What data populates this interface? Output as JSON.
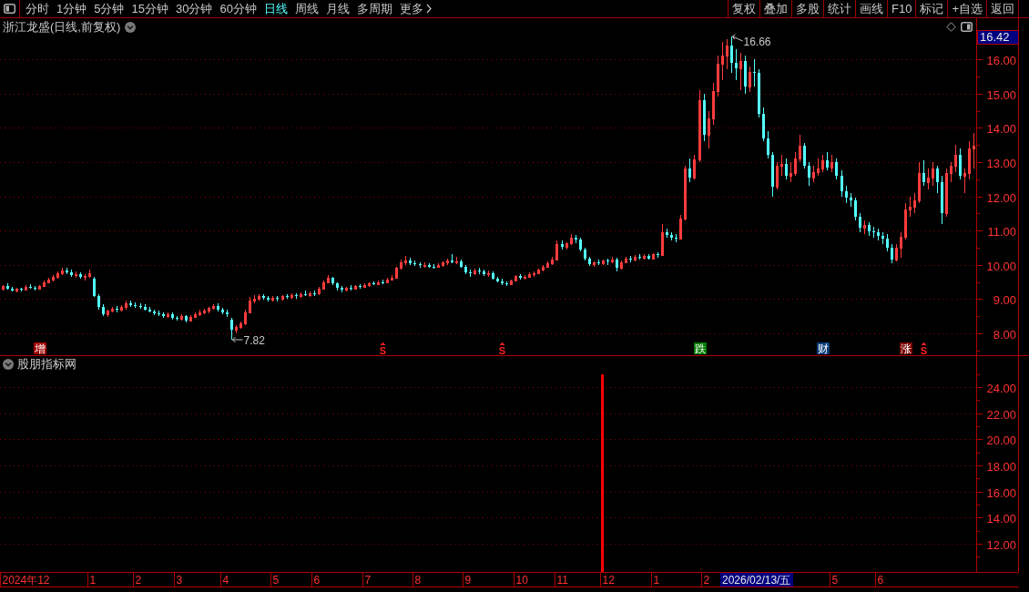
{
  "toolbar": {
    "periods": [
      {
        "label": "分时",
        "selected": false,
        "kind": "period"
      },
      {
        "label": "1分钟",
        "selected": false,
        "kind": "period"
      },
      {
        "label": "5分钟",
        "selected": false,
        "kind": "period"
      },
      {
        "label": "15分钟",
        "selected": false,
        "kind": "period"
      },
      {
        "label": "30分钟",
        "selected": false,
        "kind": "period"
      },
      {
        "label": "60分钟",
        "selected": false,
        "kind": "period"
      },
      {
        "label": "日线",
        "selected": true,
        "kind": "period"
      },
      {
        "label": "周线",
        "selected": false,
        "kind": "period"
      },
      {
        "label": "月线",
        "selected": false,
        "kind": "period"
      },
      {
        "label": "多周期",
        "selected": false,
        "kind": "period"
      },
      {
        "label": "更多",
        "selected": false,
        "kind": "menu"
      }
    ],
    "actions": [
      "复权",
      "叠加",
      "多股",
      "统计",
      "画线",
      "F10",
      "标记",
      "+自选",
      "返回"
    ]
  },
  "price_pane": {
    "title": "浙江龙盛(日线,前复权)",
    "price_label": "16.42",
    "event_markers": [
      {
        "kind": "badge",
        "label": "增",
        "color": "#a00000"
      },
      {
        "kind": "signal",
        "label": "S"
      },
      {
        "kind": "signal",
        "label": "S"
      },
      {
        "kind": "badge",
        "label": "跌",
        "color": "#007a00"
      },
      {
        "kind": "badge",
        "label": "财",
        "color": "#0a3c78"
      },
      {
        "kind": "badge",
        "label": "涨",
        "color": "#7a0000"
      },
      {
        "kind": "signal",
        "label": "S"
      }
    ],
    "chart_data": [
      {
        "type": "candlestick",
        "ylim": [
          7.36,
          17.2
        ],
        "grid": true,
        "yticks": [
          {
            "value": 16,
            "label": "16.00"
          },
          {
            "value": 15,
            "label": "15.00"
          },
          {
            "value": 14,
            "label": "14.00"
          },
          {
            "value": 13,
            "label": "13.00"
          },
          {
            "value": 12,
            "label": "12.00"
          },
          {
            "value": 11,
            "label": "11.00"
          },
          {
            "value": 10,
            "label": "10.00"
          },
          {
            "value": 9,
            "label": "9.00"
          },
          {
            "value": 8,
            "label": "8.00"
          }
        ],
        "annotations": [
          "16.66",
          "7.82"
        ],
        "ohlc": [
          [
            9.3,
            9.42,
            9.26,
            9.38
          ],
          [
            9.38,
            9.45,
            9.28,
            9.31
          ],
          [
            9.31,
            9.36,
            9.22,
            9.25
          ],
          [
            9.25,
            9.33,
            9.2,
            9.3
          ],
          [
            9.3,
            9.34,
            9.21,
            9.27
          ],
          [
            9.27,
            9.4,
            9.25,
            9.36
          ],
          [
            9.36,
            9.44,
            9.3,
            9.33
          ],
          [
            9.33,
            9.38,
            9.24,
            9.29
          ],
          [
            9.29,
            9.41,
            9.27,
            9.38
          ],
          [
            9.38,
            9.55,
            9.35,
            9.5
          ],
          [
            9.5,
            9.62,
            9.45,
            9.58
          ],
          [
            9.58,
            9.7,
            9.52,
            9.66
          ],
          [
            9.66,
            9.8,
            9.6,
            9.75
          ],
          [
            9.75,
            9.9,
            9.7,
            9.84
          ],
          [
            9.84,
            9.92,
            9.72,
            9.78
          ],
          [
            9.78,
            9.86,
            9.66,
            9.7
          ],
          [
            9.7,
            9.8,
            9.62,
            9.74
          ],
          [
            9.74,
            9.78,
            9.6,
            9.65
          ],
          [
            9.65,
            9.72,
            9.55,
            9.67
          ],
          [
            9.67,
            9.85,
            9.62,
            9.75
          ],
          [
            9.6,
            9.66,
            9.05,
            9.1
          ],
          [
            9.1,
            9.15,
            8.7,
            8.78
          ],
          [
            8.78,
            8.85,
            8.5,
            8.55
          ],
          [
            8.55,
            8.7,
            8.48,
            8.66
          ],
          [
            8.66,
            8.78,
            8.6,
            8.72
          ],
          [
            8.72,
            8.8,
            8.62,
            8.68
          ],
          [
            8.68,
            8.82,
            8.64,
            8.76
          ],
          [
            8.76,
            8.95,
            8.7,
            8.88
          ],
          [
            8.88,
            8.96,
            8.78,
            8.82
          ],
          [
            8.82,
            8.9,
            8.74,
            8.8
          ],
          [
            8.8,
            8.88,
            8.72,
            8.78
          ],
          [
            8.78,
            8.84,
            8.66,
            8.7
          ],
          [
            8.7,
            8.76,
            8.6,
            8.64
          ],
          [
            8.64,
            8.7,
            8.52,
            8.58
          ],
          [
            8.58,
            8.66,
            8.5,
            8.55
          ],
          [
            8.55,
            8.62,
            8.44,
            8.5
          ],
          [
            8.5,
            8.6,
            8.46,
            8.56
          ],
          [
            8.56,
            8.62,
            8.4,
            8.44
          ],
          [
            8.44,
            8.5,
            8.36,
            8.42
          ],
          [
            8.42,
            8.55,
            8.38,
            8.5
          ],
          [
            8.5,
            8.54,
            8.32,
            8.37
          ],
          [
            8.37,
            8.52,
            8.34,
            8.48
          ],
          [
            8.48,
            8.62,
            8.44,
            8.56
          ],
          [
            8.56,
            8.68,
            8.5,
            8.6
          ],
          [
            8.6,
            8.72,
            8.55,
            8.66
          ],
          [
            8.66,
            8.78,
            8.58,
            8.74
          ],
          [
            8.74,
            8.86,
            8.68,
            8.8
          ],
          [
            8.8,
            8.88,
            8.64,
            8.69
          ],
          [
            8.69,
            8.75,
            8.56,
            8.62
          ],
          [
            8.62,
            8.7,
            8.48,
            8.55
          ],
          [
            8.4,
            8.45,
            7.82,
            8.1
          ],
          [
            8.1,
            8.25,
            8.0,
            8.18
          ],
          [
            8.18,
            8.35,
            8.12,
            8.29
          ],
          [
            8.29,
            8.7,
            8.25,
            8.62
          ],
          [
            8.62,
            9.05,
            8.58,
            8.95
          ],
          [
            8.95,
            9.12,
            8.88,
            9.02
          ],
          [
            9.02,
            9.15,
            8.96,
            9.08
          ],
          [
            9.08,
            9.14,
            8.98,
            9.04
          ],
          [
            9.04,
            9.1,
            8.94,
            8.98
          ],
          [
            8.98,
            9.08,
            8.92,
            9.03
          ],
          [
            9.03,
            9.1,
            8.94,
            9.0
          ],
          [
            9.0,
            9.12,
            8.96,
            9.08
          ],
          [
            9.08,
            9.15,
            9.0,
            9.05
          ],
          [
            9.05,
            9.16,
            9.02,
            9.12
          ],
          [
            9.12,
            9.18,
            9.02,
            9.08
          ],
          [
            9.08,
            9.2,
            9.04,
            9.15
          ],
          [
            9.15,
            9.24,
            9.08,
            9.12
          ],
          [
            9.12,
            9.22,
            9.06,
            9.18
          ],
          [
            9.18,
            9.26,
            9.1,
            9.16
          ],
          [
            9.16,
            9.35,
            9.12,
            9.3
          ],
          [
            9.3,
            9.55,
            9.28,
            9.5
          ],
          [
            9.5,
            9.7,
            9.45,
            9.62
          ],
          [
            9.62,
            9.66,
            9.4,
            9.45
          ],
          [
            9.45,
            9.5,
            9.26,
            9.32
          ],
          [
            9.32,
            9.38,
            9.2,
            9.27
          ],
          [
            9.27,
            9.36,
            9.22,
            9.33
          ],
          [
            9.33,
            9.4,
            9.26,
            9.3
          ],
          [
            9.3,
            9.42,
            9.28,
            9.38
          ],
          [
            9.38,
            9.44,
            9.3,
            9.35
          ],
          [
            9.35,
            9.46,
            9.32,
            9.42
          ],
          [
            9.42,
            9.5,
            9.36,
            9.45
          ],
          [
            9.45,
            9.52,
            9.4,
            9.44
          ],
          [
            9.44,
            9.55,
            9.42,
            9.5
          ],
          [
            9.5,
            9.58,
            9.44,
            9.48
          ],
          [
            9.48,
            9.62,
            9.45,
            9.58
          ],
          [
            9.58,
            9.7,
            9.55,
            9.62
          ],
          [
            9.62,
            9.95,
            9.6,
            9.9
          ],
          [
            9.9,
            10.15,
            9.86,
            10.07
          ],
          [
            10.07,
            10.25,
            10.0,
            10.12
          ],
          [
            10.12,
            10.2,
            9.98,
            10.05
          ],
          [
            10.05,
            10.12,
            9.96,
            10.02
          ],
          [
            10.02,
            10.08,
            9.92,
            9.98
          ],
          [
            9.98,
            10.06,
            9.9,
            10.0
          ],
          [
            10.0,
            10.04,
            9.9,
            9.95
          ],
          [
            9.95,
            10.02,
            9.88,
            9.94
          ],
          [
            9.94,
            10.05,
            9.9,
            10.0
          ],
          [
            10.0,
            10.1,
            9.95,
            10.06
          ],
          [
            10.06,
            10.18,
            10.0,
            10.12
          ],
          [
            10.12,
            10.3,
            10.05,
            10.08
          ],
          [
            10.08,
            10.22,
            10.02,
            10.1
          ],
          [
            10.1,
            10.14,
            9.9,
            9.95
          ],
          [
            9.95,
            10.0,
            9.72,
            9.78
          ],
          [
            9.78,
            9.85,
            9.66,
            9.75
          ],
          [
            9.75,
            9.88,
            9.7,
            9.84
          ],
          [
            9.84,
            9.92,
            9.74,
            9.8
          ],
          [
            9.8,
            9.86,
            9.68,
            9.72
          ],
          [
            9.72,
            9.82,
            9.66,
            9.75
          ],
          [
            9.75,
            9.8,
            9.56,
            9.6
          ],
          [
            9.6,
            9.66,
            9.48,
            9.52
          ],
          [
            9.52,
            9.6,
            9.4,
            9.46
          ],
          [
            9.46,
            9.52,
            9.38,
            9.43
          ],
          [
            9.43,
            9.58,
            9.4,
            9.55
          ],
          [
            9.55,
            9.7,
            9.52,
            9.67
          ],
          [
            9.67,
            9.74,
            9.58,
            9.62
          ],
          [
            9.62,
            9.7,
            9.56,
            9.66
          ],
          [
            9.66,
            9.78,
            9.62,
            9.72
          ],
          [
            9.72,
            9.8,
            9.66,
            9.75
          ],
          [
            9.75,
            9.88,
            9.72,
            9.85
          ],
          [
            9.85,
            9.98,
            9.8,
            9.94
          ],
          [
            9.94,
            10.1,
            9.9,
            10.05
          ],
          [
            10.05,
            10.22,
            10.0,
            10.15
          ],
          [
            10.15,
            10.7,
            10.12,
            10.6
          ],
          [
            10.6,
            10.72,
            10.45,
            10.52
          ],
          [
            10.52,
            10.66,
            10.44,
            10.62
          ],
          [
            10.62,
            10.9,
            10.58,
            10.8
          ],
          [
            10.8,
            10.88,
            10.62,
            10.73
          ],
          [
            10.73,
            10.78,
            10.4,
            10.45
          ],
          [
            10.45,
            10.5,
            10.12,
            10.18
          ],
          [
            10.18,
            10.24,
            9.96,
            10.02
          ],
          [
            10.02,
            10.1,
            9.94,
            10.06
          ],
          [
            10.06,
            10.14,
            10.0,
            10.04
          ],
          [
            10.04,
            10.16,
            10.0,
            10.12
          ],
          [
            10.12,
            10.18,
            9.98,
            10.1
          ],
          [
            10.1,
            10.22,
            10.04,
            10.16
          ],
          [
            10.16,
            10.2,
            9.8,
            9.9
          ],
          [
            9.9,
            10.12,
            9.86,
            10.08
          ],
          [
            10.08,
            10.24,
            10.04,
            10.17
          ],
          [
            10.17,
            10.26,
            10.08,
            10.14
          ],
          [
            10.14,
            10.28,
            10.1,
            10.22
          ],
          [
            10.22,
            10.3,
            10.14,
            10.2
          ],
          [
            10.2,
            10.32,
            10.16,
            10.25
          ],
          [
            10.25,
            10.3,
            10.14,
            10.18
          ],
          [
            10.18,
            10.34,
            10.14,
            10.3
          ],
          [
            10.3,
            10.36,
            10.2,
            10.28
          ],
          [
            10.28,
            11.2,
            10.26,
            10.95
          ],
          [
            10.95,
            11.05,
            10.8,
            10.88
          ],
          [
            10.88,
            10.95,
            10.7,
            10.78
          ],
          [
            10.78,
            10.9,
            10.66,
            10.76
          ],
          [
            10.76,
            11.45,
            10.74,
            11.35
          ],
          [
            11.35,
            12.9,
            11.3,
            12.8
          ],
          [
            12.8,
            13.1,
            12.4,
            12.55
          ],
          [
            12.55,
            13.2,
            12.5,
            13.07
          ],
          [
            13.07,
            15.1,
            13.0,
            14.8
          ],
          [
            14.8,
            15.0,
            13.6,
            13.8
          ],
          [
            13.8,
            14.5,
            13.4,
            14.27
          ],
          [
            14.27,
            15.3,
            14.1,
            15.07
          ],
          [
            15.07,
            16.1,
            14.9,
            15.87
          ],
          [
            15.87,
            16.5,
            15.4,
            16.1
          ],
          [
            16.1,
            16.6,
            15.7,
            16.4
          ],
          [
            16.4,
            16.66,
            15.6,
            15.9
          ],
          [
            15.9,
            16.3,
            15.4,
            15.73
          ],
          [
            15.73,
            16.2,
            15.1,
            15.95
          ],
          [
            15.95,
            16.1,
            15.0,
            15.2
          ],
          [
            15.2,
            15.8,
            15.05,
            15.62
          ],
          [
            15.62,
            16.0,
            15.2,
            15.6
          ],
          [
            15.6,
            15.7,
            14.3,
            14.4
          ],
          [
            14.4,
            14.6,
            13.6,
            13.7
          ],
          [
            13.7,
            13.9,
            13.1,
            13.2
          ],
          [
            13.2,
            13.3,
            12.0,
            12.28
          ],
          [
            12.28,
            13.0,
            12.2,
            12.9
          ],
          [
            12.9,
            13.2,
            12.6,
            12.94
          ],
          [
            12.94,
            13.1,
            12.5,
            12.6
          ],
          [
            12.6,
            13.0,
            12.4,
            12.67
          ],
          [
            12.67,
            13.3,
            12.6,
            13.1
          ],
          [
            13.1,
            13.8,
            13.0,
            13.47
          ],
          [
            13.47,
            13.55,
            12.8,
            12.9
          ],
          [
            12.9,
            13.0,
            12.3,
            12.54
          ],
          [
            12.54,
            12.9,
            12.4,
            12.7
          ],
          [
            12.7,
            13.1,
            12.6,
            12.8
          ],
          [
            12.8,
            13.2,
            12.7,
            13.05
          ],
          [
            13.05,
            13.3,
            12.75,
            12.85
          ],
          [
            12.85,
            13.2,
            12.7,
            13.0
          ],
          [
            13.0,
            13.1,
            12.5,
            12.6
          ],
          [
            12.6,
            12.75,
            12.0,
            12.14
          ],
          [
            12.14,
            12.3,
            11.8,
            11.95
          ],
          [
            11.95,
            12.1,
            11.7,
            11.88
          ],
          [
            11.88,
            11.95,
            11.3,
            11.4
          ],
          [
            11.4,
            11.5,
            10.95,
            11.08
          ],
          [
            11.08,
            11.3,
            10.9,
            11.15
          ],
          [
            11.15,
            11.25,
            10.85,
            10.98
          ],
          [
            10.98,
            11.1,
            10.8,
            10.95
          ],
          [
            10.95,
            11.05,
            10.7,
            10.85
          ],
          [
            10.85,
            10.95,
            10.6,
            10.76
          ],
          [
            10.76,
            10.9,
            10.4,
            10.5
          ],
          [
            10.5,
            10.6,
            10.05,
            10.15
          ],
          [
            10.15,
            10.6,
            10.1,
            10.5
          ],
          [
            10.5,
            10.95,
            10.2,
            10.81
          ],
          [
            10.81,
            11.8,
            10.75,
            11.61
          ],
          [
            11.61,
            12.0,
            11.4,
            11.7
          ],
          [
            11.7,
            12.1,
            11.5,
            11.88
          ],
          [
            11.88,
            13.0,
            11.8,
            12.67
          ],
          [
            12.67,
            13.05,
            12.3,
            12.4
          ],
          [
            12.4,
            12.8,
            12.2,
            12.54
          ],
          [
            12.54,
            13.0,
            12.3,
            12.8
          ],
          [
            12.8,
            12.9,
            12.1,
            12.4
          ],
          [
            12.4,
            12.6,
            11.2,
            11.5
          ],
          [
            11.5,
            12.8,
            11.4,
            12.67
          ],
          [
            12.67,
            13.0,
            12.4,
            12.9
          ],
          [
            12.9,
            13.5,
            12.7,
            13.2
          ],
          [
            13.2,
            13.4,
            12.5,
            12.6
          ],
          [
            12.6,
            12.8,
            12.1,
            12.67
          ],
          [
            12.67,
            13.6,
            12.5,
            13.4
          ],
          [
            13.4,
            13.85,
            12.8,
            13.47
          ]
        ]
      }
    ]
  },
  "indicator_pane": {
    "title": "股朋指标网",
    "chart_data": [
      {
        "type": "bar",
        "ylim": [
          9.84,
          26.37
        ],
        "grid": true,
        "yticks": [
          {
            "value": 24,
            "label": "24.00"
          },
          {
            "value": 22,
            "label": "22.00"
          },
          {
            "value": 20,
            "label": "20.00"
          },
          {
            "value": 18,
            "label": "18.00"
          },
          {
            "value": 16,
            "label": "16.00"
          },
          {
            "value": 14,
            "label": "14.00"
          },
          {
            "value": 12,
            "label": "12.00"
          }
        ],
        "color": "#ff0000",
        "values": [
          null,
          null,
          null,
          null,
          null,
          null,
          null,
          null,
          null,
          null,
          null,
          null,
          null,
          null,
          null,
          null,
          null,
          null,
          null,
          null,
          null,
          null,
          null,
          null,
          null,
          null,
          null,
          null,
          null,
          null,
          null,
          null,
          null,
          null,
          null,
          null,
          null,
          null,
          null,
          null,
          null,
          null,
          null,
          null,
          null,
          null,
          null,
          null,
          null,
          null,
          null,
          null,
          null,
          null,
          null,
          null,
          null,
          null,
          null,
          null,
          null,
          null,
          null,
          null,
          null,
          null,
          null,
          null,
          null,
          null,
          null,
          null,
          null,
          null,
          null,
          null,
          null,
          null,
          null,
          null,
          null,
          null,
          null,
          null,
          null,
          null,
          null,
          null,
          null,
          null,
          null,
          null,
          null,
          null,
          null,
          null,
          null,
          null,
          null,
          null,
          null,
          null,
          null,
          null,
          null,
          null,
          null,
          null,
          null,
          null,
          null,
          null,
          null,
          null,
          null,
          null,
          null,
          null,
          null,
          null,
          null,
          25,
          null,
          null,
          null,
          null,
          null,
          null,
          null,
          null,
          null,
          null,
          null,
          null,
          null,
          null,
          null,
          null,
          null,
          null,
          null,
          null,
          null,
          null,
          null,
          null,
          null,
          null,
          null,
          null,
          null,
          null,
          null,
          null,
          null,
          null,
          null,
          null,
          null,
          null,
          null,
          null,
          null,
          null,
          null,
          null,
          null,
          null,
          null,
          null,
          null,
          null,
          null,
          null,
          null,
          null,
          null,
          null,
          null,
          null,
          null,
          null,
          null,
          null,
          null,
          null,
          null,
          null,
          null,
          null,
          null,
          null,
          null,
          null,
          null,
          null,
          null
        ]
      }
    ]
  },
  "date_axis": {
    "labels": [
      "2024年12",
      "1",
      "2",
      "3",
      "4",
      "5",
      "6",
      "7",
      "8",
      "9",
      "10",
      "11",
      "12",
      "1",
      "2",
      "5",
      "6"
    ],
    "cursor_label": "2026/02/13/五"
  }
}
